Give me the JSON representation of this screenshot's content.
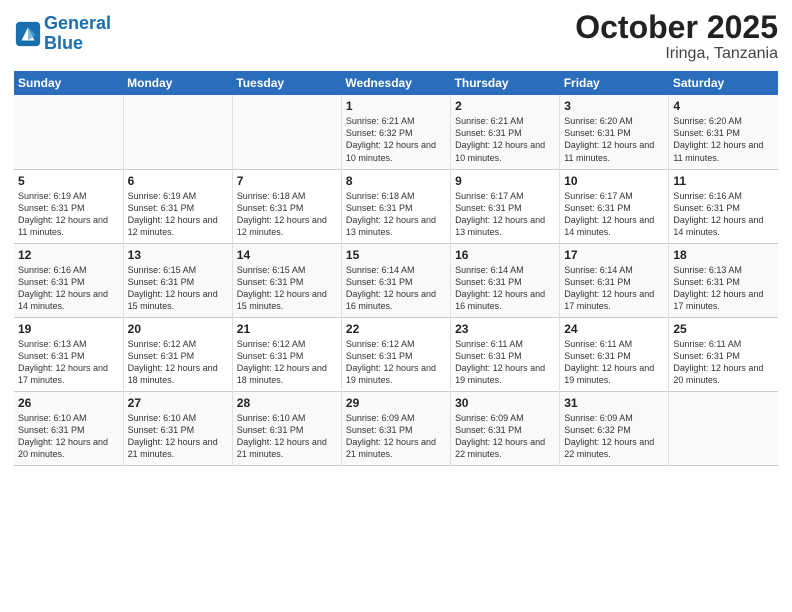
{
  "header": {
    "logo_line1": "General",
    "logo_line2": "Blue",
    "month": "October 2025",
    "location": "Iringa, Tanzania"
  },
  "weekdays": [
    "Sunday",
    "Monday",
    "Tuesday",
    "Wednesday",
    "Thursday",
    "Friday",
    "Saturday"
  ],
  "weeks": [
    [
      {
        "day": "",
        "text": ""
      },
      {
        "day": "",
        "text": ""
      },
      {
        "day": "",
        "text": ""
      },
      {
        "day": "1",
        "text": "Sunrise: 6:21 AM\nSunset: 6:32 PM\nDaylight: 12 hours and 10 minutes."
      },
      {
        "day": "2",
        "text": "Sunrise: 6:21 AM\nSunset: 6:31 PM\nDaylight: 12 hours and 10 minutes."
      },
      {
        "day": "3",
        "text": "Sunrise: 6:20 AM\nSunset: 6:31 PM\nDaylight: 12 hours and 11 minutes."
      },
      {
        "day": "4",
        "text": "Sunrise: 6:20 AM\nSunset: 6:31 PM\nDaylight: 12 hours and 11 minutes."
      }
    ],
    [
      {
        "day": "5",
        "text": "Sunrise: 6:19 AM\nSunset: 6:31 PM\nDaylight: 12 hours and 11 minutes."
      },
      {
        "day": "6",
        "text": "Sunrise: 6:19 AM\nSunset: 6:31 PM\nDaylight: 12 hours and 12 minutes."
      },
      {
        "day": "7",
        "text": "Sunrise: 6:18 AM\nSunset: 6:31 PM\nDaylight: 12 hours and 12 minutes."
      },
      {
        "day": "8",
        "text": "Sunrise: 6:18 AM\nSunset: 6:31 PM\nDaylight: 12 hours and 13 minutes."
      },
      {
        "day": "9",
        "text": "Sunrise: 6:17 AM\nSunset: 6:31 PM\nDaylight: 12 hours and 13 minutes."
      },
      {
        "day": "10",
        "text": "Sunrise: 6:17 AM\nSunset: 6:31 PM\nDaylight: 12 hours and 14 minutes."
      },
      {
        "day": "11",
        "text": "Sunrise: 6:16 AM\nSunset: 6:31 PM\nDaylight: 12 hours and 14 minutes."
      }
    ],
    [
      {
        "day": "12",
        "text": "Sunrise: 6:16 AM\nSunset: 6:31 PM\nDaylight: 12 hours and 14 minutes."
      },
      {
        "day": "13",
        "text": "Sunrise: 6:15 AM\nSunset: 6:31 PM\nDaylight: 12 hours and 15 minutes."
      },
      {
        "day": "14",
        "text": "Sunrise: 6:15 AM\nSunset: 6:31 PM\nDaylight: 12 hours and 15 minutes."
      },
      {
        "day": "15",
        "text": "Sunrise: 6:14 AM\nSunset: 6:31 PM\nDaylight: 12 hours and 16 minutes."
      },
      {
        "day": "16",
        "text": "Sunrise: 6:14 AM\nSunset: 6:31 PM\nDaylight: 12 hours and 16 minutes."
      },
      {
        "day": "17",
        "text": "Sunrise: 6:14 AM\nSunset: 6:31 PM\nDaylight: 12 hours and 17 minutes."
      },
      {
        "day": "18",
        "text": "Sunrise: 6:13 AM\nSunset: 6:31 PM\nDaylight: 12 hours and 17 minutes."
      }
    ],
    [
      {
        "day": "19",
        "text": "Sunrise: 6:13 AM\nSunset: 6:31 PM\nDaylight: 12 hours and 17 minutes."
      },
      {
        "day": "20",
        "text": "Sunrise: 6:12 AM\nSunset: 6:31 PM\nDaylight: 12 hours and 18 minutes."
      },
      {
        "day": "21",
        "text": "Sunrise: 6:12 AM\nSunset: 6:31 PM\nDaylight: 12 hours and 18 minutes."
      },
      {
        "day": "22",
        "text": "Sunrise: 6:12 AM\nSunset: 6:31 PM\nDaylight: 12 hours and 19 minutes."
      },
      {
        "day": "23",
        "text": "Sunrise: 6:11 AM\nSunset: 6:31 PM\nDaylight: 12 hours and 19 minutes."
      },
      {
        "day": "24",
        "text": "Sunrise: 6:11 AM\nSunset: 6:31 PM\nDaylight: 12 hours and 19 minutes."
      },
      {
        "day": "25",
        "text": "Sunrise: 6:11 AM\nSunset: 6:31 PM\nDaylight: 12 hours and 20 minutes."
      }
    ],
    [
      {
        "day": "26",
        "text": "Sunrise: 6:10 AM\nSunset: 6:31 PM\nDaylight: 12 hours and 20 minutes."
      },
      {
        "day": "27",
        "text": "Sunrise: 6:10 AM\nSunset: 6:31 PM\nDaylight: 12 hours and 21 minutes."
      },
      {
        "day": "28",
        "text": "Sunrise: 6:10 AM\nSunset: 6:31 PM\nDaylight: 12 hours and 21 minutes."
      },
      {
        "day": "29",
        "text": "Sunrise: 6:09 AM\nSunset: 6:31 PM\nDaylight: 12 hours and 21 minutes."
      },
      {
        "day": "30",
        "text": "Sunrise: 6:09 AM\nSunset: 6:31 PM\nDaylight: 12 hours and 22 minutes."
      },
      {
        "day": "31",
        "text": "Sunrise: 6:09 AM\nSunset: 6:32 PM\nDaylight: 12 hours and 22 minutes."
      },
      {
        "day": "",
        "text": ""
      }
    ]
  ]
}
